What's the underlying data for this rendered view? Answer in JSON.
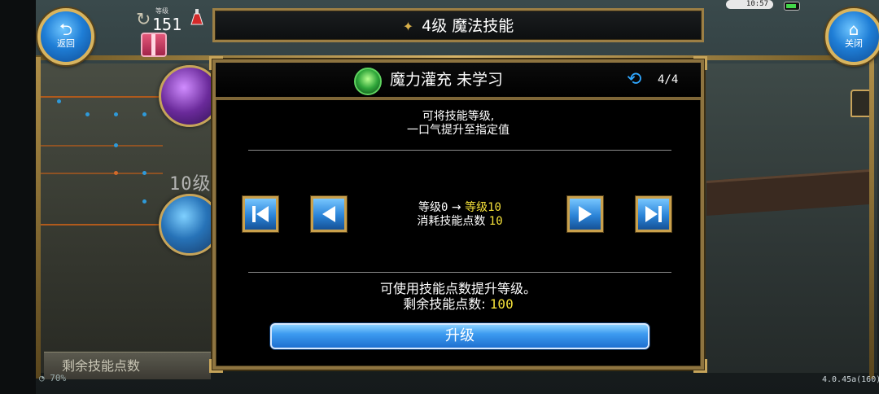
{
  "hud": {
    "back_label": "返回",
    "close_label": "关闭",
    "level_caption": "等级",
    "level_value": "151",
    "clock": "10:57"
  },
  "title": {
    "text": "4级  魔法技能"
  },
  "background": {
    "tree_level_label": "10级",
    "remaining_points_label": "剩余技能点数",
    "signal_percent": "70%",
    "version": "4.0.45a(160)"
  },
  "dialog": {
    "skill_name": "魔力灌充  未学习",
    "page": "4/4",
    "description_line1": "可将技能等级,",
    "description_line2": "一口气提升至指定值",
    "level_from_label": "等级",
    "level_from": "0",
    "arrow": "→",
    "level_to_label": "等级",
    "level_to": "10",
    "cost_label": "消耗技能点数",
    "cost_value": "10",
    "hint": "可使用技能点数提升等级。",
    "remaining_label": "剩余技能点数:",
    "remaining_value": "100",
    "upgrade_label": "升级"
  },
  "icons": {
    "back": "back-arrow-icon",
    "close": "home-icon",
    "skill": "magic-charge-icon",
    "cycle": "cycle-icon",
    "first": "skip-first-icon",
    "prev": "prev-icon",
    "next": "next-icon",
    "last": "skip-last-icon"
  },
  "colors": {
    "accent_blue": "#2b84d8",
    "gold_frame": "#8e7440",
    "highlight_yellow": "#f6e23a"
  }
}
